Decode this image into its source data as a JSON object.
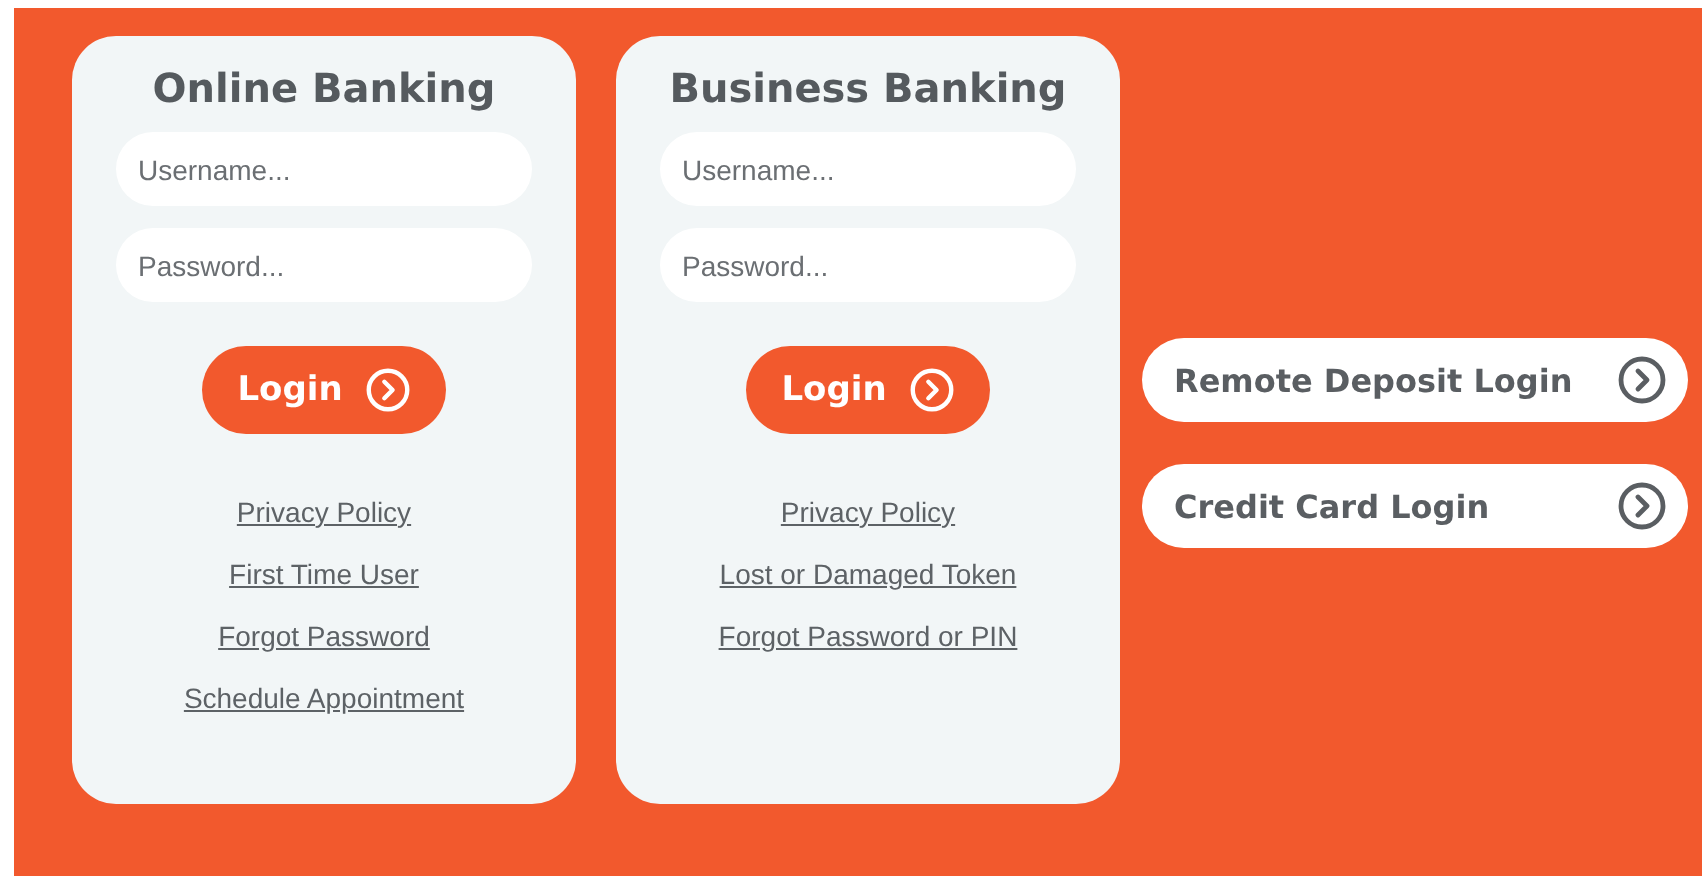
{
  "panels": [
    {
      "title": "Online Banking",
      "username_field": {
        "placeholder": "Username..."
      },
      "password_field": {
        "placeholder": "Password..."
      },
      "login_button": "Login",
      "links": [
        "Privacy Policy",
        "First Time User",
        "Forgot Password",
        "Schedule Appointment"
      ]
    },
    {
      "title": "Business Banking",
      "username_field": {
        "placeholder": "Username..."
      },
      "password_field": {
        "placeholder": "Password..."
      },
      "login_button": "Login",
      "links": [
        "Privacy Policy",
        "Lost or Damaged Token",
        "Forgot Password or PIN"
      ]
    }
  ],
  "quick_logins": [
    "Remote Deposit Login",
    "Credit Card Login"
  ]
}
